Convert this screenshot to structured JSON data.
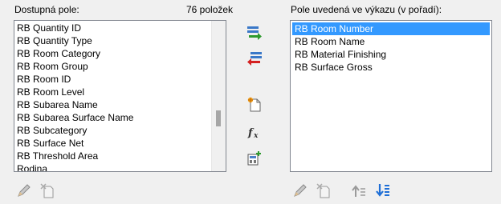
{
  "available": {
    "label": "Dostupná pole:",
    "count": "76 položek",
    "items": [
      "RB Quantity ID",
      "RB Quantity Type",
      "RB Room Category",
      "RB Room Group",
      "RB Room ID",
      "RB Room Level",
      "RB Subarea Name",
      "RB Subarea Surface Name",
      "RB Subcategory",
      "RB Surface Net",
      "RB Threshold Area",
      "Rodina"
    ]
  },
  "scheduled": {
    "label": "Pole uvedená ve výkazu (v pořadí):",
    "items": [
      "RB Room Number",
      "RB Room Name",
      "RB Material Finishing",
      "RB Surface Gross"
    ],
    "selected_index": 0
  },
  "icons": {
    "add": "arrow-right-add-icon",
    "remove": "arrow-left-remove-icon",
    "new_parameter": "new-parameter-icon",
    "formula": "formula-icon",
    "combine": "combine-parameters-icon",
    "edit": "pencil-edit-icon",
    "delete": "delete-parameter-icon",
    "move_up": "move-up-icon",
    "move_down": "move-down-icon"
  },
  "colors": {
    "selection": "#3399ff",
    "add_arrow": "#2e9a2e",
    "remove_arrow": "#d42020",
    "arrow_blue": "#1f6fd6"
  }
}
